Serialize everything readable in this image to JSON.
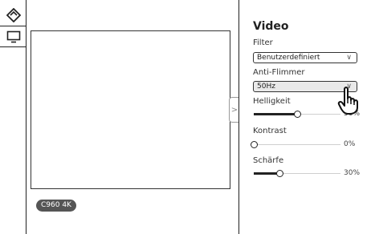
{
  "toolbar": {
    "tools": [
      {
        "icon": "diamond-logo-icon"
      },
      {
        "icon": "monitor-icon"
      }
    ]
  },
  "stage": {
    "camera_label": "C960 4K",
    "collapse_glyph": ">"
  },
  "panel": {
    "title": "Video",
    "filter": {
      "label": "Filter",
      "value": "Benutzerdefiniert"
    },
    "flicker": {
      "label": "Anti-Flimmer",
      "value": "50Hz"
    },
    "brightness": {
      "label": "Helligkeit",
      "value": 0.5,
      "display": "50%"
    },
    "contrast": {
      "label": "Kontrast",
      "value": 0.0,
      "display": "0%"
    },
    "sharpness": {
      "label": "Schärfe",
      "value": 0.3,
      "display": "30%"
    }
  }
}
